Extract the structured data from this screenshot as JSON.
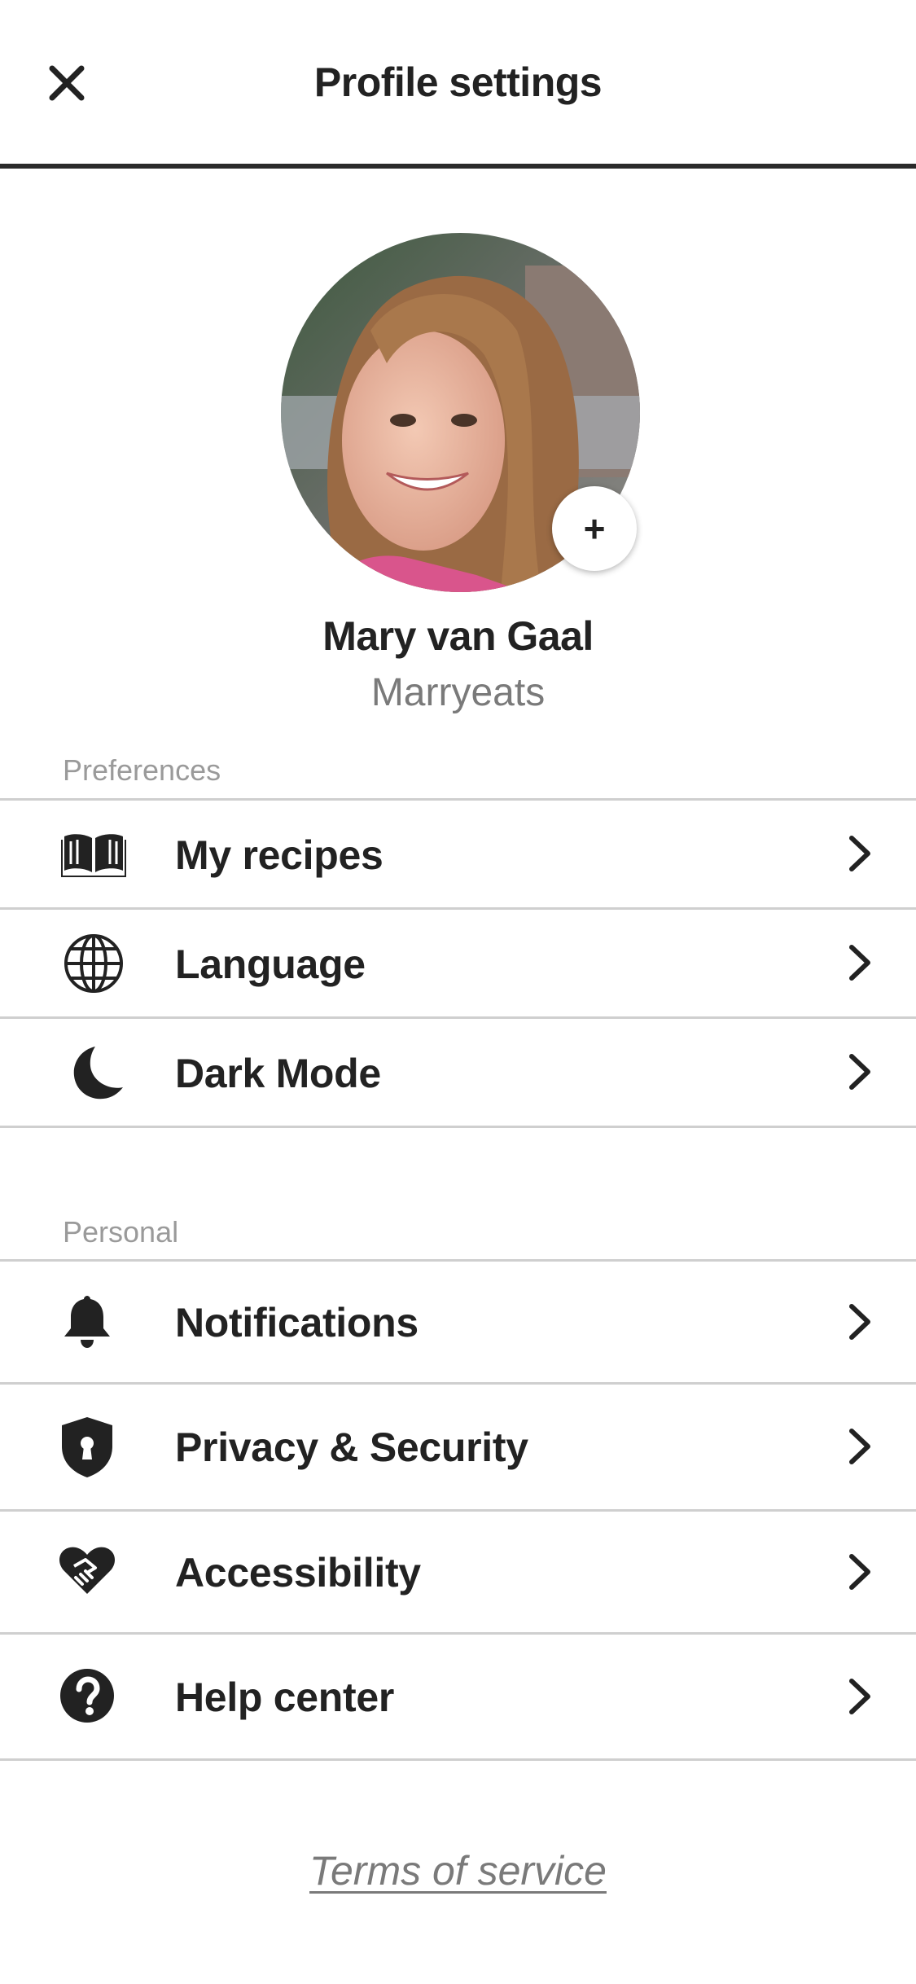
{
  "header": {
    "title": "Profile settings",
    "close_icon": "close-icon"
  },
  "profile": {
    "name": "Mary van Gaal",
    "handle": "Marryeats",
    "add_photo_label": "+"
  },
  "sections": {
    "preferences": {
      "label": "Preferences",
      "items": [
        {
          "label": "My recipes",
          "icon": "open-book-icon"
        },
        {
          "label": "Language",
          "icon": "globe-icon"
        },
        {
          "label": "Dark Mode",
          "icon": "moon-icon"
        }
      ]
    },
    "personal": {
      "label": "Personal",
      "items": [
        {
          "label": "Notifications",
          "icon": "bell-icon"
        },
        {
          "label": "Privacy & Security",
          "icon": "shield-lock-icon"
        },
        {
          "label": "Accessibility",
          "icon": "heart-handshake-icon"
        },
        {
          "label": "Help center",
          "icon": "question-circle-icon"
        }
      ]
    }
  },
  "footer": {
    "terms_label": "Terms of service"
  },
  "colors": {
    "text": "#222222",
    "muted": "#7a7a7a",
    "divider": "#cfcfcf",
    "header_rule": "#2a2a2a"
  }
}
